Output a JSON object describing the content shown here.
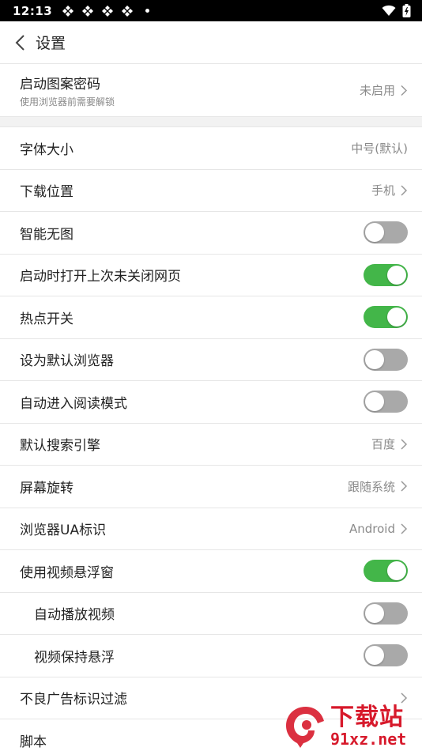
{
  "status_bar": {
    "time": "12:13"
  },
  "header": {
    "title": "设置"
  },
  "settings": {
    "pattern_lock": {
      "label": "启动图案密码",
      "sublabel": "使用浏览器前需要解锁",
      "value": "未启用"
    },
    "font_size": {
      "label": "字体大小",
      "value": "中号(默认)"
    },
    "download_location": {
      "label": "下载位置",
      "value": "手机"
    },
    "smart_no_image": {
      "label": "智能无图",
      "enabled": false
    },
    "restore_pages": {
      "label": "启动时打开上次未关闭网页",
      "enabled": true
    },
    "hotspot": {
      "label": "热点开关",
      "enabled": true
    },
    "default_browser": {
      "label": "设为默认浏览器",
      "enabled": false
    },
    "auto_reading": {
      "label": "自动进入阅读模式",
      "enabled": false
    },
    "search_engine": {
      "label": "默认搜索引擎",
      "value": "百度"
    },
    "screen_rotation": {
      "label": "屏幕旋转",
      "value": "跟随系统"
    },
    "user_agent": {
      "label": "浏览器UA标识",
      "value": "Android"
    },
    "video_float": {
      "label": "使用视频悬浮窗",
      "enabled": true
    },
    "autoplay_video": {
      "label": "自动播放视频",
      "enabled": false
    },
    "keep_float": {
      "label": "视频保持悬浮",
      "enabled": false
    },
    "ad_filter": {
      "label": "不良广告标识过滤"
    },
    "scripts": {
      "label": "脚本"
    }
  },
  "colors": {
    "toggle_on": "#43b649",
    "toggle_off": "#a9a9a9",
    "watermark": "#d7192b"
  },
  "watermark": {
    "text": "下载站",
    "url": "91xz.net"
  }
}
